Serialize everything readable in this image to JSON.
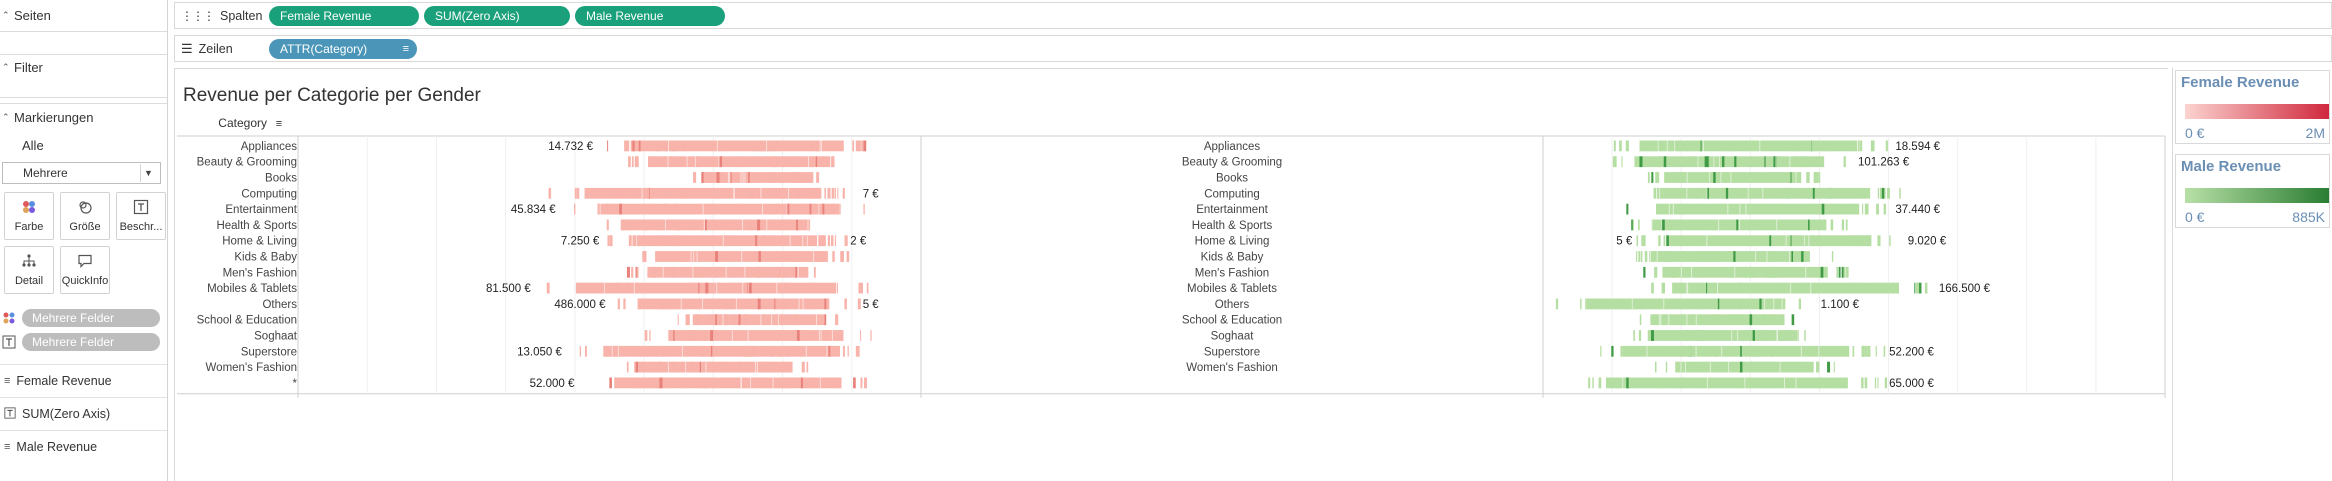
{
  "sidebar": {
    "pages_label": "Seiten",
    "filter_label": "Filter",
    "marks_label": "Markierungen",
    "marks_all": "Alle",
    "marks_type": "Mehrere",
    "buttons": {
      "color": "Farbe",
      "size": "Größe",
      "label": "Beschr...",
      "detail": "Detail",
      "tooltip": "QuickInfo"
    },
    "field_pills": [
      "Mehrere Felder",
      "Mehrere Felder"
    ],
    "measures": [
      "Female Revenue",
      "SUM(Zero Axis)",
      "Male Revenue"
    ]
  },
  "shelves": {
    "columns_label": "Spalten",
    "columns_pills": [
      "Female Revenue",
      "SUM(Zero Axis)",
      "Male Revenue"
    ],
    "rows_label": "Zeilen",
    "rows_pill": "ATTR(Category)"
  },
  "view": {
    "title": "Revenue per Categorie per Gender",
    "category_header": "Category"
  },
  "legends": {
    "female": {
      "title": "Female Revenue",
      "min": "0 €",
      "max": "2M",
      "color_low": "#fbd3cf",
      "color_high": "#d0283d"
    },
    "male": {
      "title": "Male Revenue",
      "min": "0 €",
      "max": "885K",
      "color_low": "#b8e0a6",
      "color_high": "#2a7d33"
    }
  },
  "chart_data": {
    "type": "bar",
    "colors": {
      "female": "#f8b3aa",
      "female_dark": "#e8827a",
      "male": "#b5dea2",
      "male_dark": "#3f9b45"
    },
    "categories": [
      "Appliances",
      "Beauty & Grooming",
      "Books",
      "Computing",
      "Entertainment",
      "Health & Sports",
      "Home & Living",
      "Kids & Baby",
      "Men's Fashion",
      "Mobiles & Tablets",
      "Others",
      "School & Education",
      "Soghaat",
      "Superstore",
      "Women's Fashion",
      "*"
    ],
    "female_labels": [
      {
        "row": 0,
        "text": "14.732 €",
        "side": "left"
      },
      {
        "row": 3,
        "text": "7 €",
        "side": "right"
      },
      {
        "row": 4,
        "text": "45.834 €",
        "side": "left"
      },
      {
        "row": 6,
        "text": "7.250 €",
        "side": "left"
      },
      {
        "row": 6,
        "text": "2 €",
        "side": "right"
      },
      {
        "row": 9,
        "text": "81.500 €",
        "side": "left"
      },
      {
        "row": 10,
        "text": "486.000 €",
        "side": "left"
      },
      {
        "row": 10,
        "text": "5 €",
        "side": "right"
      },
      {
        "row": 13,
        "text": "13.050 €",
        "side": "left"
      },
      {
        "row": 15,
        "text": "52.000 €",
        "side": "left"
      }
    ],
    "male_labels": [
      {
        "row": 0,
        "text": "18.594 €",
        "side": "right"
      },
      {
        "row": 1,
        "text": "101.263 €",
        "side": "right"
      },
      {
        "row": 4,
        "text": "37.440 €",
        "side": "right"
      },
      {
        "row": 6,
        "text": "5 €",
        "side": "left"
      },
      {
        "row": 6,
        "text": "9.020 €",
        "side": "right"
      },
      {
        "row": 9,
        "text": "166.500 €",
        "side": "right"
      },
      {
        "row": 10,
        "text": "1.100 €",
        "side": "right"
      },
      {
        "row": 13,
        "text": "52.200 €",
        "side": "right"
      },
      {
        "row": 15,
        "text": "65.000 €",
        "side": "right"
      }
    ],
    "female_spans": [
      [
        0.48,
        0.93
      ],
      [
        0.52,
        0.9
      ],
      [
        0.62,
        0.85
      ],
      [
        0.4,
        0.9
      ],
      [
        0.42,
        0.93
      ],
      [
        0.47,
        0.87
      ],
      [
        0.49,
        0.88
      ],
      [
        0.53,
        0.89
      ],
      [
        0.52,
        0.86
      ],
      [
        0.38,
        0.93
      ],
      [
        0.5,
        0.9
      ],
      [
        0.6,
        0.88
      ],
      [
        0.55,
        0.92
      ],
      [
        0.43,
        0.93
      ],
      [
        0.5,
        0.83
      ],
      [
        0.45,
        0.93
      ]
    ],
    "male_spans": [
      [
        0.1,
        0.56
      ],
      [
        0.1,
        0.5
      ],
      [
        0.16,
        0.45
      ],
      [
        0.13,
        0.58
      ],
      [
        0.13,
        0.56
      ],
      [
        0.13,
        0.5
      ],
      [
        0.15,
        0.58
      ],
      [
        0.13,
        0.47
      ],
      [
        0.15,
        0.5
      ],
      [
        0.15,
        0.63
      ],
      [
        0.02,
        0.44
      ],
      [
        0.15,
        0.42
      ],
      [
        0.13,
        0.45
      ],
      [
        0.07,
        0.55
      ],
      [
        0.18,
        0.47
      ],
      [
        0.04,
        0.55
      ]
    ]
  }
}
